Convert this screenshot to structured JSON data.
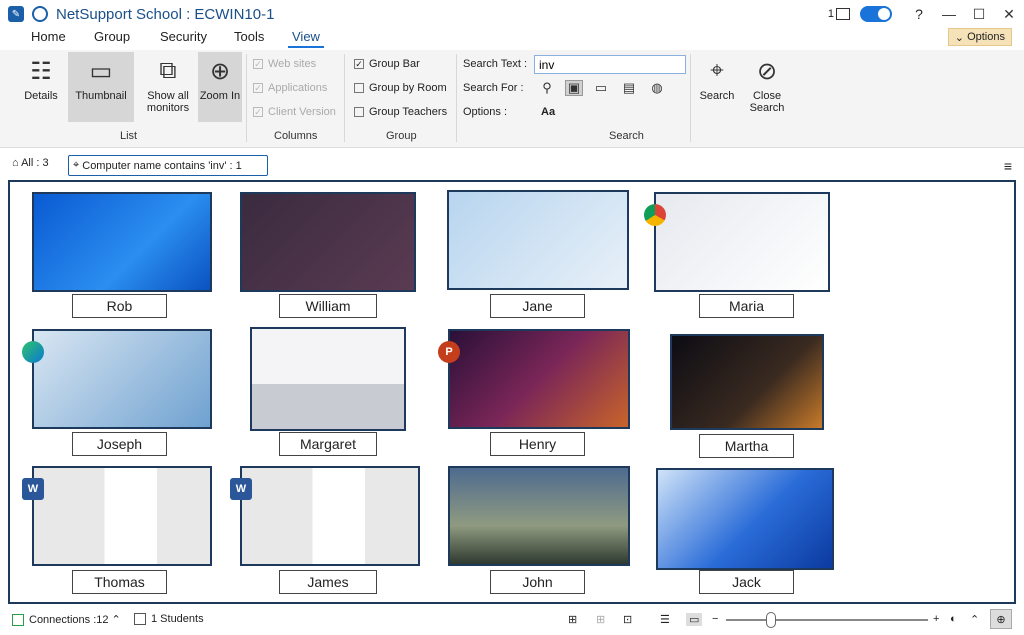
{
  "window": {
    "title": "NetSupport School : ECWIN10-1",
    "badge_count": "1",
    "help": "?"
  },
  "menu": {
    "tabs": [
      "Home",
      "Group",
      "Security",
      "Tools",
      "View"
    ],
    "active": "View",
    "options": "Options"
  },
  "ribbon": {
    "list": {
      "label": "List",
      "details": "Details",
      "thumbnail": "Thumbnail",
      "show_all": "Show all monitors",
      "zoom_in": "Zoom In"
    },
    "columns": {
      "label": "Columns",
      "web_sites": "Web sites",
      "applications": "Applications",
      "client_version": "Client Version"
    },
    "group": {
      "label": "Group",
      "group_bar": "Group Bar",
      "group_by_room": "Group by Room",
      "group_teachers": "Group Teachers"
    },
    "search": {
      "label": "Search",
      "search_text_label": "Search Text :",
      "search_text_value": "inv",
      "search_for_label": "Search For :",
      "options_label": "Options :",
      "options_case": "Aa",
      "search_btn": "Search",
      "close_search_btn": "Close Search"
    }
  },
  "crumbs": {
    "all": "All : 3",
    "filter": "Computer name contains 'inv' : 1"
  },
  "students": [
    {
      "name": "Rob",
      "app": ""
    },
    {
      "name": "William",
      "app": ""
    },
    {
      "name": "Jane",
      "app": ""
    },
    {
      "name": "Maria",
      "app": "chrome"
    },
    {
      "name": "Joseph",
      "app": "edge"
    },
    {
      "name": "Margaret",
      "app": ""
    },
    {
      "name": "Henry",
      "app": "powerpoint"
    },
    {
      "name": "Martha",
      "app": ""
    },
    {
      "name": "Thomas",
      "app": "word"
    },
    {
      "name": "James",
      "app": "word"
    },
    {
      "name": "John",
      "app": ""
    },
    {
      "name": "Jack",
      "app": ""
    }
  ],
  "status": {
    "connections": "Connections :12",
    "students": "1 Students"
  },
  "colors": {
    "accent": "#1a73d8",
    "frame": "#1d3a5c",
    "options_bg": "#f6e2b8"
  }
}
